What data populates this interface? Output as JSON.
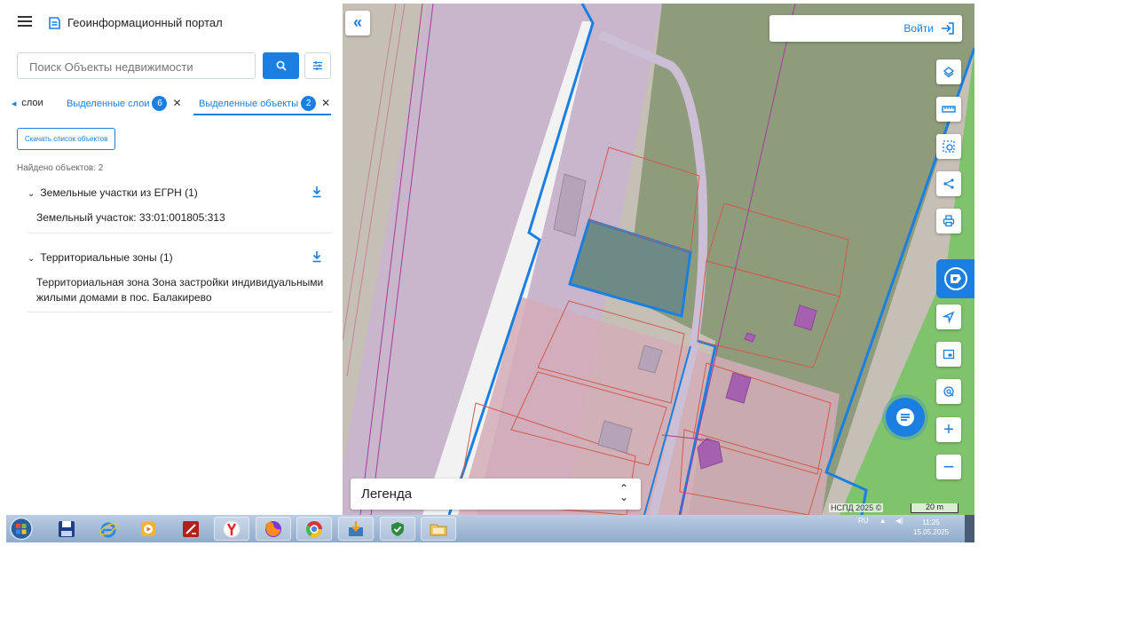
{
  "app": {
    "title": "Геоинформационный портал",
    "menu_icon": "hamburger-icon",
    "logo_icon": "portal-logo-icon"
  },
  "search": {
    "placeholder": "Поиск Объекты недвижимости",
    "search_icon": "search-icon",
    "filter_icon": "filter-sliders-icon"
  },
  "tabs": [
    {
      "label": "слои",
      "badge": null
    },
    {
      "label": "Выделенные слои",
      "badge": "6"
    },
    {
      "label": "Выделенные объекты",
      "badge": "2"
    }
  ],
  "results": {
    "download_label": "Скачать список объектов",
    "found_text": "Найдено объектов: 2",
    "groups": [
      {
        "title": "Земельные участки из ЕГРН (1)",
        "items": [
          "Земельный участок: 33:01:001805:313"
        ]
      },
      {
        "title": "Территориальные зоны (1)",
        "items": [
          "Территориальная зона Зона застройки индивидуальными жилыми домами в пос. Балакирево"
        ]
      }
    ]
  },
  "map": {
    "login_label": "Войти",
    "legend_label": "Легенда",
    "attribution": "НСПД 2025 ©",
    "scale_label": "20 m",
    "tools": [
      "layers-icon",
      "ruler-icon",
      "select-area-icon",
      "share-icon",
      "print-icon",
      "nspd-brand-icon",
      "locate-icon",
      "minimap-icon",
      "geolocation-icon",
      "zoom-in-icon",
      "zoom-out-icon"
    ],
    "chat_icon": "chat-icon",
    "colors": {
      "accent": "#1a7fe0",
      "green_zone": "#7ec26a",
      "purple_zone": "#c4aac9",
      "olive_zone": "#8d9a78"
    }
  },
  "taskbar": {
    "apps": [
      "windows-start-icon",
      "save-icon",
      "internet-explorer-icon",
      "media-player-icon",
      "pdf-icon",
      "yandex-browser-icon",
      "firefox-icon",
      "chrome-icon",
      "download-app-icon",
      "shield-app-icon",
      "folder-icon"
    ],
    "language": "RU",
    "time": "11:25",
    "date": "15.05.2025"
  }
}
